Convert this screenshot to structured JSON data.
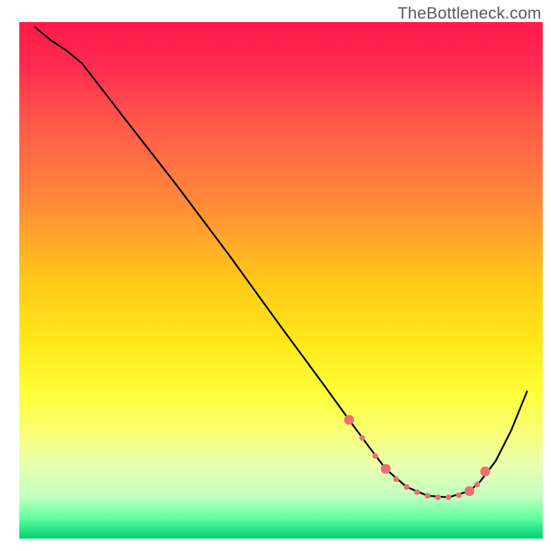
{
  "watermark": "TheBottleneck.com",
  "chart_data": {
    "type": "line",
    "title": "",
    "xlabel": "",
    "ylabel": "",
    "xlim": [
      0,
      100
    ],
    "ylim": [
      0,
      100
    ],
    "background_gradient": {
      "stops": [
        {
          "offset": 0.0,
          "color": "#ff1a4a"
        },
        {
          "offset": 0.08,
          "color": "#ff2a4f"
        },
        {
          "offset": 0.2,
          "color": "#ff5a4a"
        },
        {
          "offset": 0.35,
          "color": "#ff8a3a"
        },
        {
          "offset": 0.5,
          "color": "#ffc81a"
        },
        {
          "offset": 0.62,
          "color": "#ffe81a"
        },
        {
          "offset": 0.72,
          "color": "#ffff3a"
        },
        {
          "offset": 0.8,
          "color": "#f8ff7a"
        },
        {
          "offset": 0.86,
          "color": "#e8ffb0"
        },
        {
          "offset": 0.92,
          "color": "#c0ffc0"
        },
        {
          "offset": 0.96,
          "color": "#60ffa0"
        },
        {
          "offset": 1.0,
          "color": "#00d070"
        }
      ]
    },
    "series": [
      {
        "name": "curve",
        "type": "line",
        "color": "#000000",
        "width": 2.5,
        "x": [
          3.0,
          6.0,
          9.0,
          12.0,
          20.0,
          30.0,
          40.0,
          50.0,
          58.0,
          63.0,
          67.0,
          70.0,
          74.0,
          78.0,
          82.0,
          86.0,
          88.0,
          91.0,
          94.0,
          97.0
        ],
        "y": [
          99.0,
          96.5,
          94.5,
          92.0,
          81.5,
          68.5,
          55.0,
          41.0,
          30.0,
          23.0,
          17.5,
          13.5,
          10.0,
          8.3,
          8.0,
          9.2,
          11.0,
          15.0,
          21.0,
          28.5
        ]
      },
      {
        "name": "markers",
        "type": "scatter",
        "color": "#ef6f6f",
        "size_small": 8,
        "size_large": 14,
        "points": [
          {
            "x": 63.0,
            "y": 23.0,
            "size": "large"
          },
          {
            "x": 65.5,
            "y": 19.5,
            "size": "small"
          },
          {
            "x": 68.0,
            "y": 16.0,
            "size": "small"
          },
          {
            "x": 70.0,
            "y": 13.5,
            "size": "large"
          },
          {
            "x": 72.0,
            "y": 11.5,
            "size": "small"
          },
          {
            "x": 74.0,
            "y": 10.0,
            "size": "small"
          },
          {
            "x": 76.0,
            "y": 9.0,
            "size": "small"
          },
          {
            "x": 78.0,
            "y": 8.3,
            "size": "small"
          },
          {
            "x": 80.0,
            "y": 8.0,
            "size": "small"
          },
          {
            "x": 82.0,
            "y": 8.0,
            "size": "small"
          },
          {
            "x": 84.0,
            "y": 8.4,
            "size": "small"
          },
          {
            "x": 86.0,
            "y": 9.2,
            "size": "large"
          },
          {
            "x": 87.5,
            "y": 10.5,
            "size": "small"
          },
          {
            "x": 89.0,
            "y": 13.0,
            "size": "large"
          }
        ]
      }
    ]
  }
}
